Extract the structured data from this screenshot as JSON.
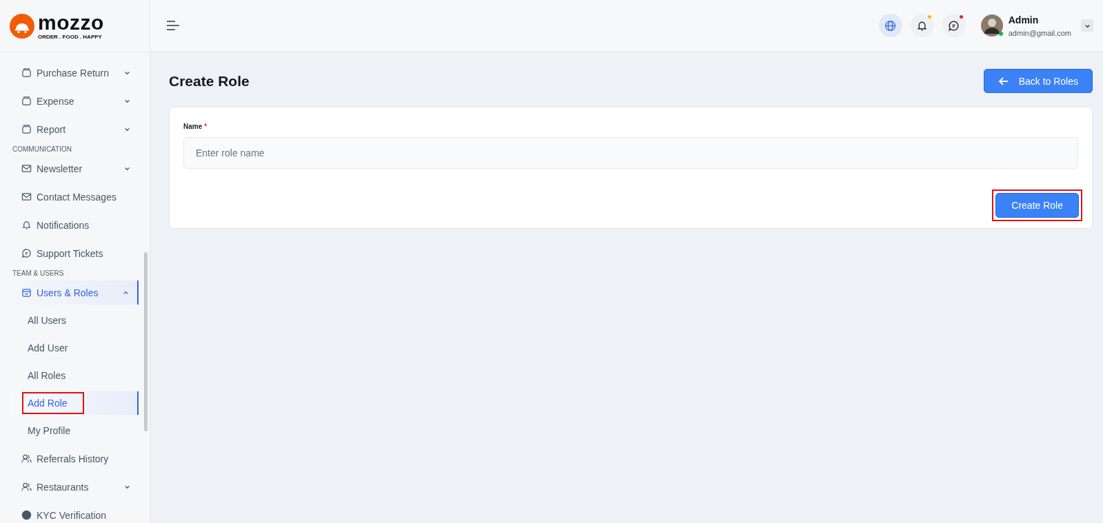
{
  "logo": {
    "name": "mozzo",
    "tagline": "ORDER . FOOD . HAPPY"
  },
  "sidebar": {
    "items": [
      {
        "kind": "item",
        "label": "Purchase Return",
        "expanded": false,
        "selected": false
      },
      {
        "kind": "item",
        "label": "Expense",
        "expanded": false,
        "selected": false
      },
      {
        "kind": "item",
        "label": "Report",
        "expanded": false,
        "selected": false
      },
      {
        "kind": "section",
        "label": "COMMUNICATION"
      },
      {
        "kind": "item",
        "label": "Newsletter",
        "expanded": false,
        "selected": false
      },
      {
        "kind": "item",
        "label": "Contact Messages",
        "selected": false
      },
      {
        "kind": "item",
        "label": "Notifications",
        "selected": false
      },
      {
        "kind": "item",
        "label": "Support Tickets",
        "selected": false
      },
      {
        "kind": "section",
        "label": "TEAM & USERS"
      },
      {
        "kind": "item",
        "label": "Users & Roles",
        "expanded": true,
        "selected": true,
        "children": [
          {
            "label": "All Users",
            "selected": false,
            "highlighted": false
          },
          {
            "label": "Add User",
            "selected": false,
            "highlighted": false
          },
          {
            "label": "All Roles",
            "selected": false,
            "highlighted": false
          },
          {
            "label": "Add Role",
            "selected": true,
            "highlighted": true
          },
          {
            "label": "My Profile",
            "selected": false,
            "highlighted": false
          }
        ]
      },
      {
        "kind": "item",
        "label": "Referrals History",
        "selected": false
      },
      {
        "kind": "item",
        "label": "Restaurants",
        "expanded": false,
        "selected": false
      },
      {
        "kind": "item",
        "label": "KYC Verification",
        "selected": false
      }
    ]
  },
  "header": {
    "icons": [
      {
        "kind": "globe",
        "active": true
      },
      {
        "kind": "bell",
        "active": false,
        "color": "#f5b800"
      },
      {
        "kind": "chat",
        "active": false,
        "color": "#e5262b"
      }
    ],
    "user": {
      "name": "Admin",
      "email": "admin@gmail.com",
      "online": true
    }
  },
  "page": {
    "title": "Create Role",
    "back_button": "Back to Roles",
    "form": {
      "label": "Name",
      "required_mark": "*",
      "placeholder": "Enter role name",
      "submit": "Create Role",
      "submit_highlighted": true
    }
  }
}
